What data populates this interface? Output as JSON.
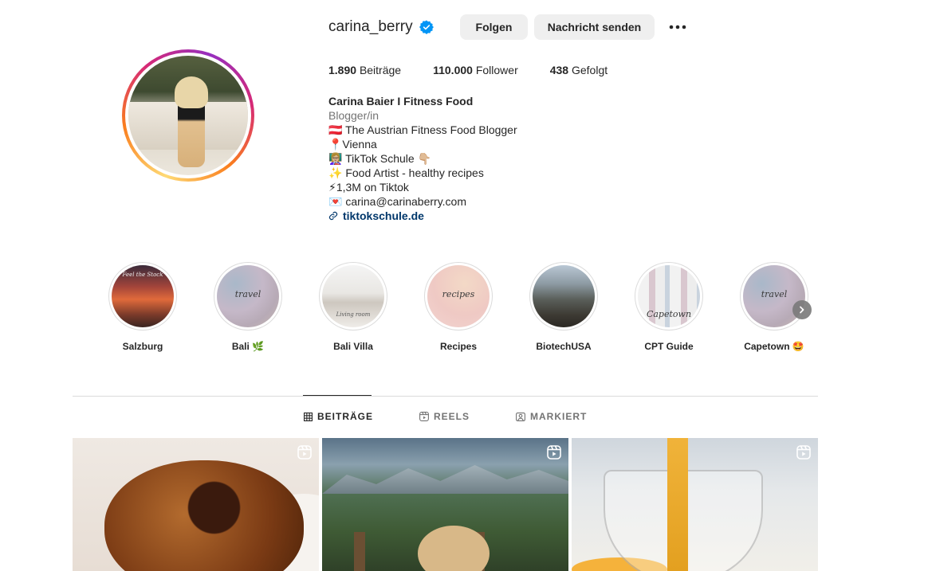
{
  "profile": {
    "username": "carina_berry",
    "verified": true,
    "follow_label": "Folgen",
    "message_label": "Nachricht senden"
  },
  "stats": {
    "posts_count": "1.890",
    "posts_label": "Beiträge",
    "followers_count": "110.000",
    "followers_label": "Follower",
    "following_count": "438",
    "following_label": "Gefolgt"
  },
  "bio": {
    "name": "Carina Baier I Fitness Food",
    "category": "Blogger/in",
    "lines": [
      "🇦🇹 The Austrian Fitness Food Blogger",
      "📍Vienna",
      "👩🏼‍🏫 TikTok Schule 👇🏼",
      "✨ Food Artist - healthy recipes",
      "⚡1,3M on Tiktok",
      "💌 carina@carinaberry.com"
    ],
    "link": "tiktokschule.de"
  },
  "highlights": [
    {
      "label": "Salzburg",
      "overlay": "Feel the Stock"
    },
    {
      "label": "Bali 🌿",
      "overlay": "travel"
    },
    {
      "label": "Bali Villa",
      "overlay": "Living room"
    },
    {
      "label": "Recipes",
      "overlay": "recipes"
    },
    {
      "label": "BiotechUSA",
      "overlay": ""
    },
    {
      "label": "CPT Guide",
      "overlay": "Capetown"
    },
    {
      "label": "Capetown 🤩",
      "overlay": "travel"
    }
  ],
  "tabs": [
    {
      "label": "BEITRÄGE",
      "active": true
    },
    {
      "label": "REELS",
      "active": false
    },
    {
      "label": "MARKIERT",
      "active": false
    }
  ],
  "colors": {
    "link": "#00376b",
    "verified": "#0095f6",
    "button_bg": "#efefef"
  }
}
